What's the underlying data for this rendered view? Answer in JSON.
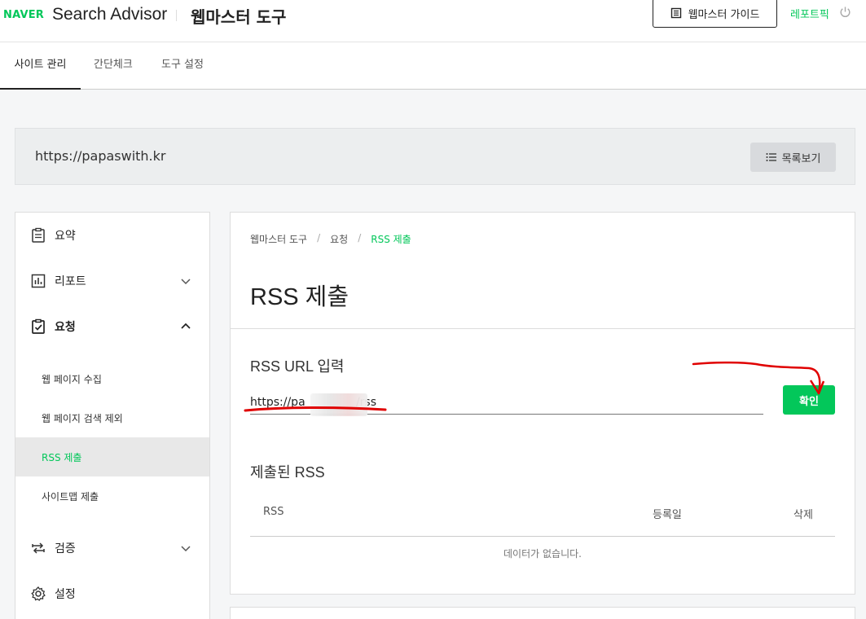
{
  "header": {
    "logo_naver": "NAVER",
    "logo_product": "Search Advisor",
    "logo_tool": "웹마스터 도구",
    "guide_button": "웹마스터 가이드",
    "user_name": "레포트픽"
  },
  "tabs": [
    {
      "label": "사이트 관리",
      "active": true
    },
    {
      "label": "간단체크"
    },
    {
      "label": "도구 설정"
    }
  ],
  "site": {
    "url": "https://papaswith.kr",
    "list_button": "목록보기"
  },
  "sidebar": {
    "items": [
      {
        "label": "요약",
        "icon": "clipboard-icon"
      },
      {
        "label": "리포트",
        "icon": "chart-icon",
        "expanded": false
      },
      {
        "label": "요청",
        "icon": "clipboard-check-icon",
        "expanded": true
      },
      {
        "label": "검증",
        "icon": "swap-icon",
        "expanded": false
      },
      {
        "label": "설정",
        "icon": "gear-icon"
      }
    ],
    "subitems": [
      {
        "label": "웹 페이지 수집"
      },
      {
        "label": "웹 페이지 검색 제외"
      },
      {
        "label": "RSS 제출",
        "active": true
      },
      {
        "label": "사이트맵 제출"
      }
    ]
  },
  "breadcrumb": [
    "웹마스터 도구",
    "요청",
    "RSS 제출"
  ],
  "page_title": "RSS 제출",
  "rss_form": {
    "label": "RSS URL 입력",
    "value": "https://pa              /rss",
    "confirm_button": "확인"
  },
  "submitted": {
    "title": "제출된 RSS",
    "columns": [
      "RSS",
      "등록일",
      "삭제"
    ],
    "empty_text": "데이터가 없습니다."
  },
  "colors": {
    "accent": "#03c75a",
    "annotation": "#e00000"
  }
}
